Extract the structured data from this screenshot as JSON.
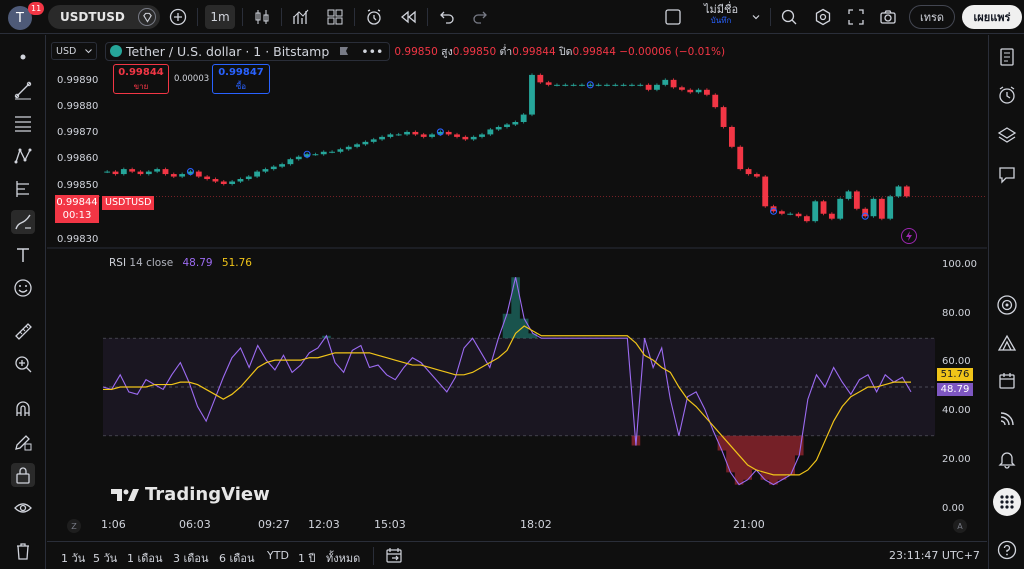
{
  "topbar": {
    "avatar_letter": "T",
    "notification_count": "11",
    "symbol": "USDTUSD",
    "interval": "1m",
    "save_line1": "ไม่มีชื่อ",
    "save_line2": "บันทึก",
    "trade_label": "เทรด",
    "publish_label": "เผยแพร่"
  },
  "legend": {
    "currency": "USD",
    "title": "Tether / U.S. dollar · 1 · Bitstamp",
    "open_value": "0.99850",
    "high_label": "สูง",
    "high_value": "0.99850",
    "low_label": "ต่ำ",
    "low_value": "0.99844",
    "close_label": "ปิด",
    "close_value": "0.99844",
    "change": "−0.00006 (−0.01%)"
  },
  "order_panel": {
    "sell_price": "0.99844",
    "sell_label": "ขาย",
    "spread": "0.00003",
    "buy_price": "0.99847",
    "buy_label": "ซื้อ"
  },
  "price_axis": {
    "labels": [
      "0.99890",
      "0.99880",
      "0.99870",
      "0.99860",
      "0.99850",
      "0.99830"
    ],
    "current_price": "0.99844",
    "countdown": "00:13",
    "current_symbol": "USDTUSD"
  },
  "rsi": {
    "name": "RSI",
    "params": "14 close",
    "value1": "48.79",
    "value2": "51.76",
    "axis_labels": [
      "100.00",
      "80.00",
      "60.00",
      "40.00",
      "20.00",
      "0.00"
    ]
  },
  "branding": {
    "logo_text": "TradingView"
  },
  "time_axis": [
    "1:06",
    "06:03",
    "09:27",
    "12:03",
    "15:03",
    "18:02",
    "21:00"
  ],
  "time_axis_buttons": {
    "left": "Z",
    "right": "A"
  },
  "bottom": {
    "ranges": [
      "1 วัน",
      "5 วัน",
      "1 เดือน",
      "3 เดือน",
      "6 เดือน",
      "YTD",
      "1 ปี",
      "ทั้งหมด"
    ],
    "clock": "23:11:47 UTC+7"
  },
  "colors": {
    "up": "#26a69a",
    "down": "#f23645",
    "rsi_line": "#9c6bf2",
    "rsi_ma": "#f0c419",
    "buy": "#2962ff"
  },
  "chart_data": {
    "type": "line",
    "price": {
      "ylim": [
        0.99826,
        0.99897
      ],
      "close": [
        0.99854,
        0.99853,
        0.99855,
        0.99854,
        0.99853,
        0.99854,
        0.99855,
        0.99853,
        0.99852,
        0.99853,
        0.99854,
        0.99852,
        0.99851,
        0.9985,
        0.99849,
        0.9985,
        0.99851,
        0.99852,
        0.99854,
        0.99855,
        0.99856,
        0.99857,
        0.99859,
        0.9986,
        0.99861,
        0.99861,
        0.99862,
        0.99862,
        0.99863,
        0.99864,
        0.99865,
        0.99866,
        0.99867,
        0.99868,
        0.99869,
        0.99869,
        0.9987,
        0.99869,
        0.99868,
        0.99869,
        0.9987,
        0.99869,
        0.99868,
        0.99867,
        0.99868,
        0.99869,
        0.99871,
        0.99872,
        0.99873,
        0.99874,
        0.99877,
        0.99893,
        0.9989,
        0.99889,
        0.99889,
        0.99889,
        0.99889,
        0.99889,
        0.99889,
        0.99889,
        0.99889,
        0.99889,
        0.99889,
        0.99889,
        0.99889,
        0.99887,
        0.99889,
        0.99891,
        0.99888,
        0.99887,
        0.99886,
        0.99887,
        0.99885,
        0.9988,
        0.99872,
        0.99864,
        0.99855,
        0.99853,
        0.99852,
        0.9984,
        0.99838,
        0.99837,
        0.99837,
        0.99836,
        0.99834,
        0.99842,
        0.99837,
        0.99835,
        0.99843,
        0.99846,
        0.99839,
        0.99836,
        0.99843,
        0.99835,
        0.99844,
        0.99848,
        0.99844
      ]
    },
    "rsi": {
      "ylim": [
        0,
        100
      ],
      "bands": [
        30,
        50,
        70
      ],
      "rsi": [
        50,
        49,
        55,
        48,
        47,
        53,
        51,
        49,
        55,
        60,
        52,
        42,
        36,
        45,
        54,
        62,
        66,
        58,
        67,
        61,
        57,
        63,
        56,
        59,
        64,
        66,
        71,
        60,
        56,
        65,
        67,
        58,
        59,
        55,
        53,
        58,
        62,
        60,
        56,
        52,
        48,
        54,
        66,
        70,
        64,
        58,
        70,
        80,
        95,
        78,
        72,
        70,
        70,
        70,
        70,
        70,
        70,
        70,
        70,
        70,
        70,
        70,
        26,
        70,
        58,
        66,
        45,
        30,
        46,
        48,
        41,
        32,
        24,
        15,
        10,
        12,
        16,
        12,
        10,
        12,
        14,
        22,
        45,
        55,
        50,
        58,
        52,
        47,
        53,
        55,
        48,
        55,
        52,
        54,
        48
      ],
      "rsi_ma": [
        49,
        49,
        50,
        50,
        50,
        50,
        51,
        51,
        51,
        52,
        52,
        51,
        49,
        47,
        45,
        47,
        50,
        54,
        58,
        60,
        61,
        61,
        61,
        61,
        62,
        62,
        63,
        64,
        64,
        64,
        64,
        64,
        63,
        62,
        61,
        60,
        59,
        59,
        58,
        57,
        56,
        55,
        55,
        56,
        58,
        60,
        62,
        65,
        72,
        75,
        73,
        71,
        71,
        71,
        71,
        71,
        71,
        71,
        71,
        71,
        71,
        71,
        68,
        63,
        61,
        58,
        56,
        50,
        45,
        42,
        38,
        34,
        30,
        26,
        22,
        18,
        16,
        15,
        14,
        14,
        14,
        14,
        16,
        20,
        28,
        36,
        42,
        46,
        48,
        50,
        50,
        51,
        52,
        52,
        52
      ]
    }
  }
}
